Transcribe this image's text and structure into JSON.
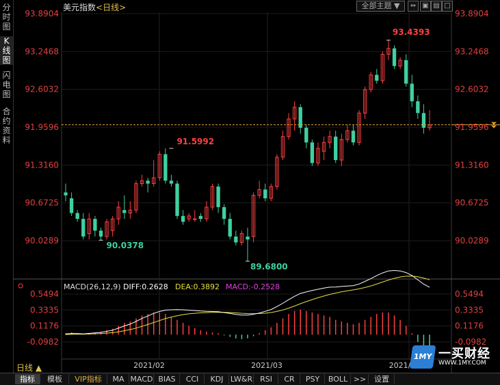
{
  "sidebar": {
    "tabs": [
      {
        "label": [
          "分",
          "时",
          "图"
        ],
        "active": false
      },
      {
        "label": [
          "K",
          "线",
          "图"
        ],
        "active": true
      },
      {
        "label": [
          "闪",
          "电",
          "图"
        ],
        "active": false
      },
      {
        "label": [
          "合",
          "约",
          "资",
          "料"
        ],
        "active": false
      }
    ]
  },
  "header": {
    "name": "美元指数",
    "prefix": "<",
    "period": "日线",
    "suffix": ">"
  },
  "toolbar": {
    "theme_label": "全部主题",
    "theme_arrow": "▼",
    "buttons": [
      "⇔",
      "▣",
      "▤",
      "□"
    ]
  },
  "price_axis": [
    "93.8904",
    "93.2468",
    "92.6032",
    "91.9596",
    "91.3160",
    "90.6725",
    "90.0289"
  ],
  "macd_axis": [
    "0.5494",
    "0.3335",
    "0.1176",
    "-0.0982"
  ],
  "annotations": {
    "high1": "91.5992",
    "low1": "90.0378",
    "low2": "89.6800",
    "high2": "93.4393"
  },
  "macd_legend": {
    "title": "MACD(26,12,9)",
    "diff": "DIFF:0.2628",
    "dea": "DEA:0.3892",
    "macd": "MACD:-0.2528"
  },
  "date_labels": [
    "2021/02",
    "2021/03",
    "2021/0"
  ],
  "period_label": "日线 ▲",
  "colors": {
    "up": "#ff4040",
    "down": "#40d0a0",
    "diff_line": "#ffffff",
    "dea_line": "#e8e040",
    "accent": "#e0c050",
    "dashed": "#e0a030"
  },
  "candles": [
    [
      90.85,
      91.0,
      90.7,
      90.8
    ],
    [
      90.75,
      90.85,
      90.45,
      90.5
    ],
    [
      90.5,
      90.55,
      90.35,
      90.4
    ],
    [
      90.4,
      90.5,
      90.05,
      90.1
    ],
    [
      90.15,
      90.5,
      90.05,
      90.4
    ],
    [
      90.4,
      90.45,
      90.1,
      90.2
    ],
    [
      90.2,
      90.25,
      90.04,
      90.1
    ],
    [
      90.1,
      90.4,
      90.05,
      90.35
    ],
    [
      90.2,
      90.45,
      90.1,
      90.4
    ],
    [
      90.4,
      90.7,
      90.3,
      90.6
    ],
    [
      90.55,
      90.8,
      90.4,
      90.5
    ],
    [
      90.5,
      90.7,
      90.4,
      90.55
    ],
    [
      90.55,
      91.05,
      90.5,
      91.0
    ],
    [
      91.0,
      91.15,
      90.95,
      91.05
    ],
    [
      91.05,
      91.1,
      90.85,
      91.0
    ],
    [
      91.0,
      91.4,
      90.95,
      91.1
    ],
    [
      91.1,
      91.55,
      91.05,
      91.5
    ],
    [
      91.5,
      91.6,
      91.0,
      91.05
    ],
    [
      91.05,
      91.15,
      90.95,
      91.0
    ],
    [
      91.0,
      91.05,
      90.4,
      90.45
    ],
    [
      90.45,
      90.55,
      90.3,
      90.35
    ],
    [
      90.4,
      90.5,
      90.35,
      90.45
    ],
    [
      90.4,
      90.55,
      90.35,
      90.4
    ],
    [
      90.45,
      90.5,
      90.35,
      90.4
    ],
    [
      90.4,
      90.7,
      90.35,
      90.6
    ],
    [
      90.6,
      91.0,
      90.55,
      90.95
    ],
    [
      90.95,
      91.0,
      90.5,
      90.6
    ],
    [
      90.6,
      90.65,
      90.3,
      90.4
    ],
    [
      90.4,
      90.5,
      90.05,
      90.1
    ],
    [
      90.1,
      90.2,
      89.95,
      90.0
    ],
    [
      90.0,
      90.2,
      89.95,
      90.15
    ],
    [
      90.1,
      90.25,
      89.68,
      90.05
    ],
    [
      90.1,
      90.85,
      90.0,
      90.8
    ],
    [
      90.8,
      91.05,
      90.75,
      90.9
    ],
    [
      90.9,
      91.0,
      90.7,
      90.75
    ],
    [
      90.75,
      91.0,
      90.7,
      90.95
    ],
    [
      90.95,
      91.5,
      90.9,
      91.45
    ],
    [
      91.45,
      91.9,
      91.4,
      91.8
    ],
    [
      91.8,
      92.2,
      91.75,
      92.1
    ],
    [
      92.1,
      92.4,
      91.9,
      92.3
    ],
    [
      92.3,
      92.35,
      91.85,
      91.95
    ],
    [
      91.95,
      92.0,
      91.6,
      91.7
    ],
    [
      91.7,
      91.75,
      91.3,
      91.35
    ],
    [
      91.35,
      91.7,
      91.3,
      91.6
    ],
    [
      91.55,
      91.8,
      91.4,
      91.7
    ],
    [
      91.7,
      91.9,
      91.6,
      91.8
    ],
    [
      91.8,
      91.9,
      91.35,
      91.4
    ],
    [
      91.4,
      91.85,
      91.3,
      91.75
    ],
    [
      91.75,
      92.0,
      91.7,
      91.9
    ],
    [
      91.9,
      92.0,
      91.65,
      91.7
    ],
    [
      91.7,
      92.25,
      91.65,
      92.2
    ],
    [
      92.2,
      92.65,
      92.1,
      92.6
    ],
    [
      92.6,
      92.9,
      92.55,
      92.85
    ],
    [
      92.85,
      92.95,
      92.7,
      92.75
    ],
    [
      92.75,
      93.25,
      92.7,
      93.2
    ],
    [
      93.2,
      93.44,
      93.1,
      93.3
    ],
    [
      93.3,
      93.35,
      92.95,
      93.0
    ],
    [
      93.0,
      93.15,
      92.95,
      93.1
    ],
    [
      93.1,
      93.2,
      92.65,
      92.7
    ],
    [
      92.7,
      92.85,
      92.3,
      92.4
    ],
    [
      92.4,
      92.5,
      92.1,
      92.2
    ],
    [
      92.2,
      92.35,
      91.85,
      91.95
    ],
    [
      91.95,
      92.25,
      91.9,
      92.0
    ]
  ],
  "macd_hist": [
    0.02,
    0.03,
    0.02,
    0.01,
    0.02,
    0.03,
    0.04,
    0.06,
    0.08,
    0.12,
    0.16,
    0.18,
    0.22,
    0.26,
    0.28,
    0.3,
    0.3,
    0.28,
    0.24,
    0.2,
    0.16,
    0.12,
    0.09,
    0.06,
    0.04,
    0.03,
    0.02,
    -0.01,
    -0.03,
    -0.05,
    -0.06,
    -0.05,
    -0.02,
    0.02,
    0.06,
    0.1,
    0.16,
    0.22,
    0.28,
    0.32,
    0.34,
    0.32,
    0.3,
    0.28,
    0.26,
    0.24,
    0.2,
    0.18,
    0.16,
    0.14,
    0.16,
    0.2,
    0.24,
    0.28,
    0.3,
    0.3,
    0.26,
    0.2,
    0.12,
    0.02,
    -0.1,
    -0.2,
    -0.25
  ]
}
